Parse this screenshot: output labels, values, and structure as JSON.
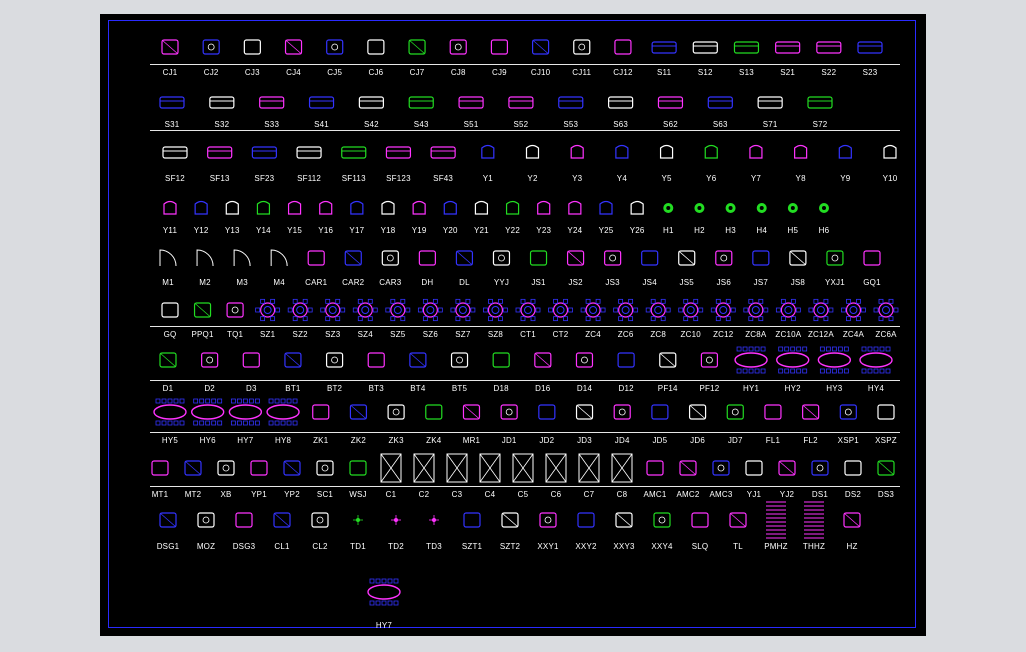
{
  "colors": {
    "background": "#000000",
    "frame": "#2a2aff",
    "label": "#ffffff",
    "magenta": "#ff33ff",
    "blue": "#3333ff",
    "white": "#ffffff",
    "green": "#22dd22",
    "red": "#ff2020",
    "yellow": "#ffff33",
    "cyan": "#33ffff"
  },
  "rows": [
    {
      "items": [
        "CJ1",
        "CJ2",
        "CJ3",
        "CJ4",
        "CJ5",
        "CJ6",
        "CJ7",
        "CJ8",
        "CJ9",
        "CJ10",
        "CJ11",
        "CJ12",
        "S11",
        "S12",
        "S13",
        "S21",
        "S22",
        "S23"
      ]
    },
    {
      "items": [
        "S31",
        "S32",
        "S33",
        "S41",
        "S42",
        "S43",
        "S51",
        "S52",
        "S53",
        "S63",
        "S62",
        "S63",
        "S71",
        "S72"
      ]
    },
    {
      "items": [
        "SF12",
        "SF13",
        "SF23",
        "SF112",
        "SF113",
        "SF123",
        "SF43",
        "Y1",
        "Y2",
        "Y3",
        "Y4",
        "Y5",
        "Y6",
        "Y7",
        "Y8",
        "Y9",
        "Y10"
      ]
    },
    {
      "items": [
        "Y11",
        "Y12",
        "Y13",
        "Y14",
        "Y15",
        "Y16",
        "Y17",
        "Y18",
        "Y19",
        "Y20",
        "Y21",
        "Y22",
        "Y23",
        "Y24",
        "Y25",
        "Y26",
        "H1",
        "H2",
        "H3",
        "H4",
        "H5",
        "H6"
      ]
    },
    {
      "items": [
        "M1",
        "M2",
        "M3",
        "M4",
        "CAR1",
        "CAR2",
        "CAR3",
        "DH",
        "DL",
        "YYJ",
        "JS1",
        "JS2",
        "JS3",
        "JS4",
        "JS5",
        "JS6",
        "JS7",
        "JS8",
        "YXJ1",
        "GQ1"
      ]
    },
    {
      "items": [
        "GQ",
        "PPQ1",
        "TQ1",
        "SZ1",
        "SZ2",
        "SZ3",
        "SZ4",
        "SZ5",
        "SZ6",
        "SZ7",
        "SZ8",
        "CT1",
        "CT2",
        "ZC4",
        "ZC6",
        "ZC8",
        "ZC10",
        "ZC12",
        "ZC8A",
        "ZC10A",
        "ZC12A",
        "ZC4A",
        "ZC6A"
      ]
    },
    {
      "items": [
        "D1",
        "D2",
        "D3",
        "BT1",
        "BT2",
        "BT3",
        "BT4",
        "BT5",
        "D18",
        "D16",
        "D14",
        "D12",
        "PF14",
        "PF12",
        "HY1",
        "HY2",
        "HY3",
        "HY4"
      ]
    },
    {
      "items": [
        "HY5",
        "HY6",
        "HY7",
        "HY8",
        "ZK1",
        "ZK2",
        "ZK3",
        "ZK4",
        "MR1",
        "JD1",
        "JD2",
        "JD3",
        "JD4",
        "JD5",
        "JD6",
        "JD7",
        "FL1",
        "FL2",
        "XSP1",
        "XSPZ"
      ]
    },
    {
      "items": [
        "MT1",
        "MT2",
        "XB",
        "YP1",
        "YP2",
        "SC1",
        "WSJ",
        "C1",
        "C2",
        "C3",
        "C4",
        "C5",
        "C6",
        "C7",
        "C8",
        "AMC1",
        "AMC2",
        "AMC3",
        "YJ1",
        "YJ2",
        "DS1",
        "DS2",
        "DS3"
      ]
    },
    {
      "items": [
        "DSG1",
        "MOZ",
        "DSG3",
        "CL1",
        "CL2",
        "TD1",
        "TD2",
        "TD3",
        "SZT1",
        "SZT2",
        "XXY1",
        "XXY2",
        "XXY3",
        "XXY4",
        "SLQ",
        "TL",
        "PMHZ",
        "THHZ",
        "HZ"
      ]
    },
    {
      "items": [
        "HY7"
      ]
    }
  ]
}
